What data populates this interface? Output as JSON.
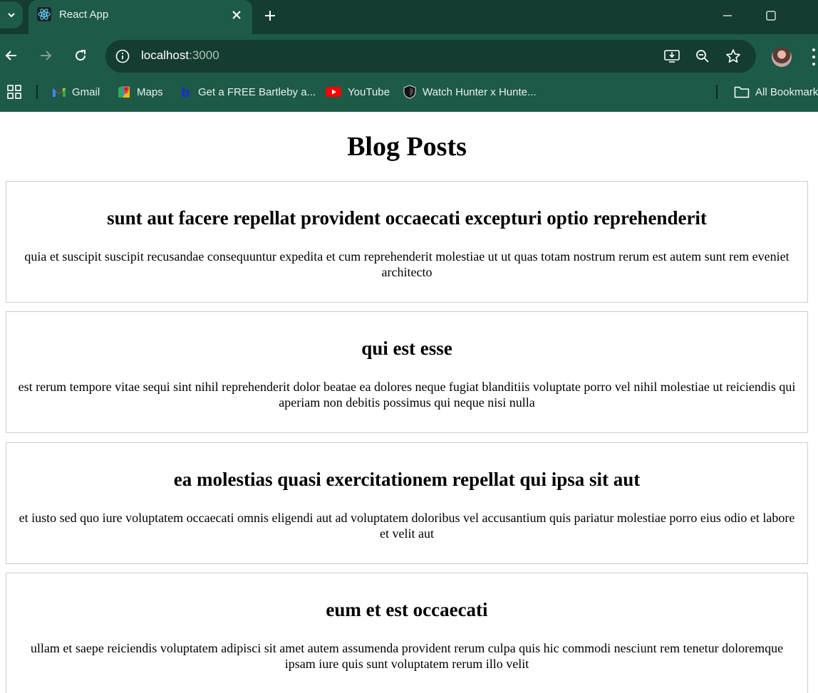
{
  "browser": {
    "tab": {
      "title": "React App",
      "favicon": "react-icon"
    },
    "address": {
      "host": "localhost",
      "port": ":3000"
    },
    "toolbar_icons": [
      "back-icon",
      "forward-icon",
      "reload-icon",
      "site-info-icon",
      "install-icon",
      "zoom-icon",
      "star-icon",
      "avatar",
      "menu-icon"
    ],
    "bookmarks": [
      {
        "label": "Gmail",
        "icon": "gmail-icon"
      },
      {
        "label": "Maps",
        "icon": "maps-icon"
      },
      {
        "label": "Get a FREE Bartleby a...",
        "icon": "bartleby-icon"
      },
      {
        "label": "YouTube",
        "icon": "youtube-icon"
      },
      {
        "label": "Watch Hunter x Hunte...",
        "icon": "shield-icon"
      }
    ],
    "all_bookmarks": "All Bookmarks",
    "colors": {
      "frame": "#143c30",
      "toolbar": "#1d5a47"
    }
  },
  "page": {
    "title": "Blog Posts",
    "posts": [
      {
        "title": "sunt aut facere repellat provident occaecati excepturi optio reprehenderit",
        "body": "quia et suscipit suscipit recusandae consequuntur expedita et cum reprehenderit molestiae ut ut quas totam nostrum rerum est autem sunt rem eveniet architecto"
      },
      {
        "title": "qui est esse",
        "body": "est rerum tempore vitae sequi sint nihil reprehenderit dolor beatae ea dolores neque fugiat blanditiis voluptate porro vel nihil molestiae ut reiciendis qui aperiam non debitis possimus qui neque nisi nulla"
      },
      {
        "title": "ea molestias quasi exercitationem repellat qui ipsa sit aut",
        "body": "et iusto sed quo iure voluptatem occaecati omnis eligendi aut ad voluptatem doloribus vel accusantium quis pariatur molestiae porro eius odio et labore et velit aut"
      },
      {
        "title": "eum et est occaecati",
        "body": "ullam et saepe reiciendis voluptatem adipisci sit amet autem assumenda provident rerum culpa quis hic commodi nesciunt rem tenetur doloremque ipsam iure quis sunt voluptatem rerum illo velit"
      }
    ]
  }
}
